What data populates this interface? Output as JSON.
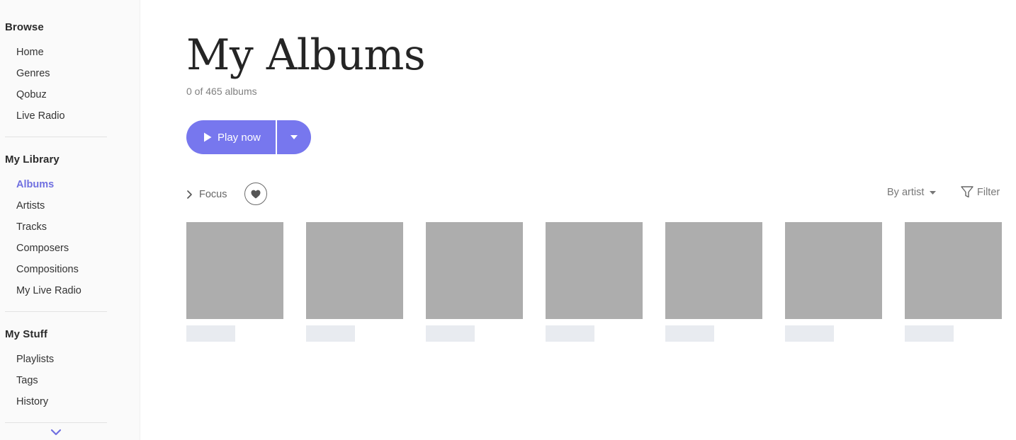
{
  "sidebar": {
    "browse": {
      "heading": "Browse",
      "items": [
        "Home",
        "Genres",
        "Qobuz",
        "Live Radio"
      ]
    },
    "library": {
      "heading": "My Library",
      "items": [
        "Albums",
        "Artists",
        "Tracks",
        "Composers",
        "Compositions",
        "My Live Radio"
      ],
      "active": "Albums"
    },
    "stuff": {
      "heading": "My Stuff",
      "items": [
        "Playlists",
        "Tags",
        "History"
      ]
    },
    "more_icon": "chevron-down-icon"
  },
  "main": {
    "title": "My Albums",
    "count": "0 of 465 albums",
    "play_label": "Play now",
    "focus_label": "Focus",
    "sort_label": "By artist",
    "filter_label": "Filter",
    "album_placeholders": 7
  },
  "colors": {
    "accent": "#7777ee",
    "active_nav": "#7070e0",
    "cover_placeholder": "#adadad",
    "title_placeholder": "#e8ebf0"
  }
}
